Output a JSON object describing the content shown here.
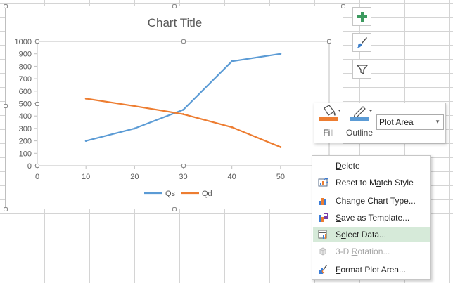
{
  "chart": {
    "title": "Chart Title",
    "series": [
      {
        "name": "Qs",
        "color": "#5b9bd5"
      },
      {
        "name": "Qd",
        "color": "#ed7d31"
      }
    ]
  },
  "chart_data": {
    "type": "line",
    "title": "Chart Title",
    "x": [
      10,
      20,
      30,
      40,
      50
    ],
    "xlim": [
      0,
      60
    ],
    "ylim": [
      0,
      1000
    ],
    "x_ticks": [
      0,
      10,
      20,
      30,
      40,
      50
    ],
    "y_ticks": [
      0,
      100,
      200,
      300,
      400,
      500,
      600,
      700,
      800,
      900,
      1000
    ],
    "series": [
      {
        "name": "Qs",
        "values": [
          200,
          300,
          450,
          840,
          900
        ],
        "color": "#5b9bd5"
      },
      {
        "name": "Qd",
        "values": [
          540,
          480,
          415,
          310,
          150
        ],
        "color": "#ed7d31"
      }
    ],
    "legend": "bottom",
    "grid": false
  },
  "side_buttons": [
    {
      "icon": "plus-icon"
    },
    {
      "icon": "paintbrush-icon"
    },
    {
      "icon": "filter-icon"
    }
  ],
  "mini_toolbar": {
    "fill_label": "Fill",
    "outline_label": "Outline",
    "element_select_value": "Plot Area",
    "fill_color": "#ed7d31",
    "outline_color": "#5b9bd5"
  },
  "context_menu": [
    {
      "label": "Delete",
      "underline": "D",
      "icon": "delete-icon",
      "enabled": true
    },
    {
      "label": "Reset to Match Style",
      "underline": "a",
      "icon": "reset-style-icon",
      "enabled": true
    },
    {
      "label": "Change Chart Type...",
      "underline": "Y",
      "icon": "chart-type-icon",
      "enabled": true
    },
    {
      "label": "Save as Template...",
      "underline": "S",
      "icon": "save-template-icon",
      "enabled": true
    },
    {
      "label": "Select Data...",
      "underline": "e",
      "icon": "select-data-icon",
      "enabled": true,
      "highlighted": true
    },
    {
      "label": "3-D Rotation...",
      "underline": "R",
      "icon": "rotation-3d-icon",
      "enabled": false
    },
    {
      "label": "Format Plot Area...",
      "underline": "F",
      "icon": "format-plot-area-icon",
      "enabled": true
    }
  ]
}
